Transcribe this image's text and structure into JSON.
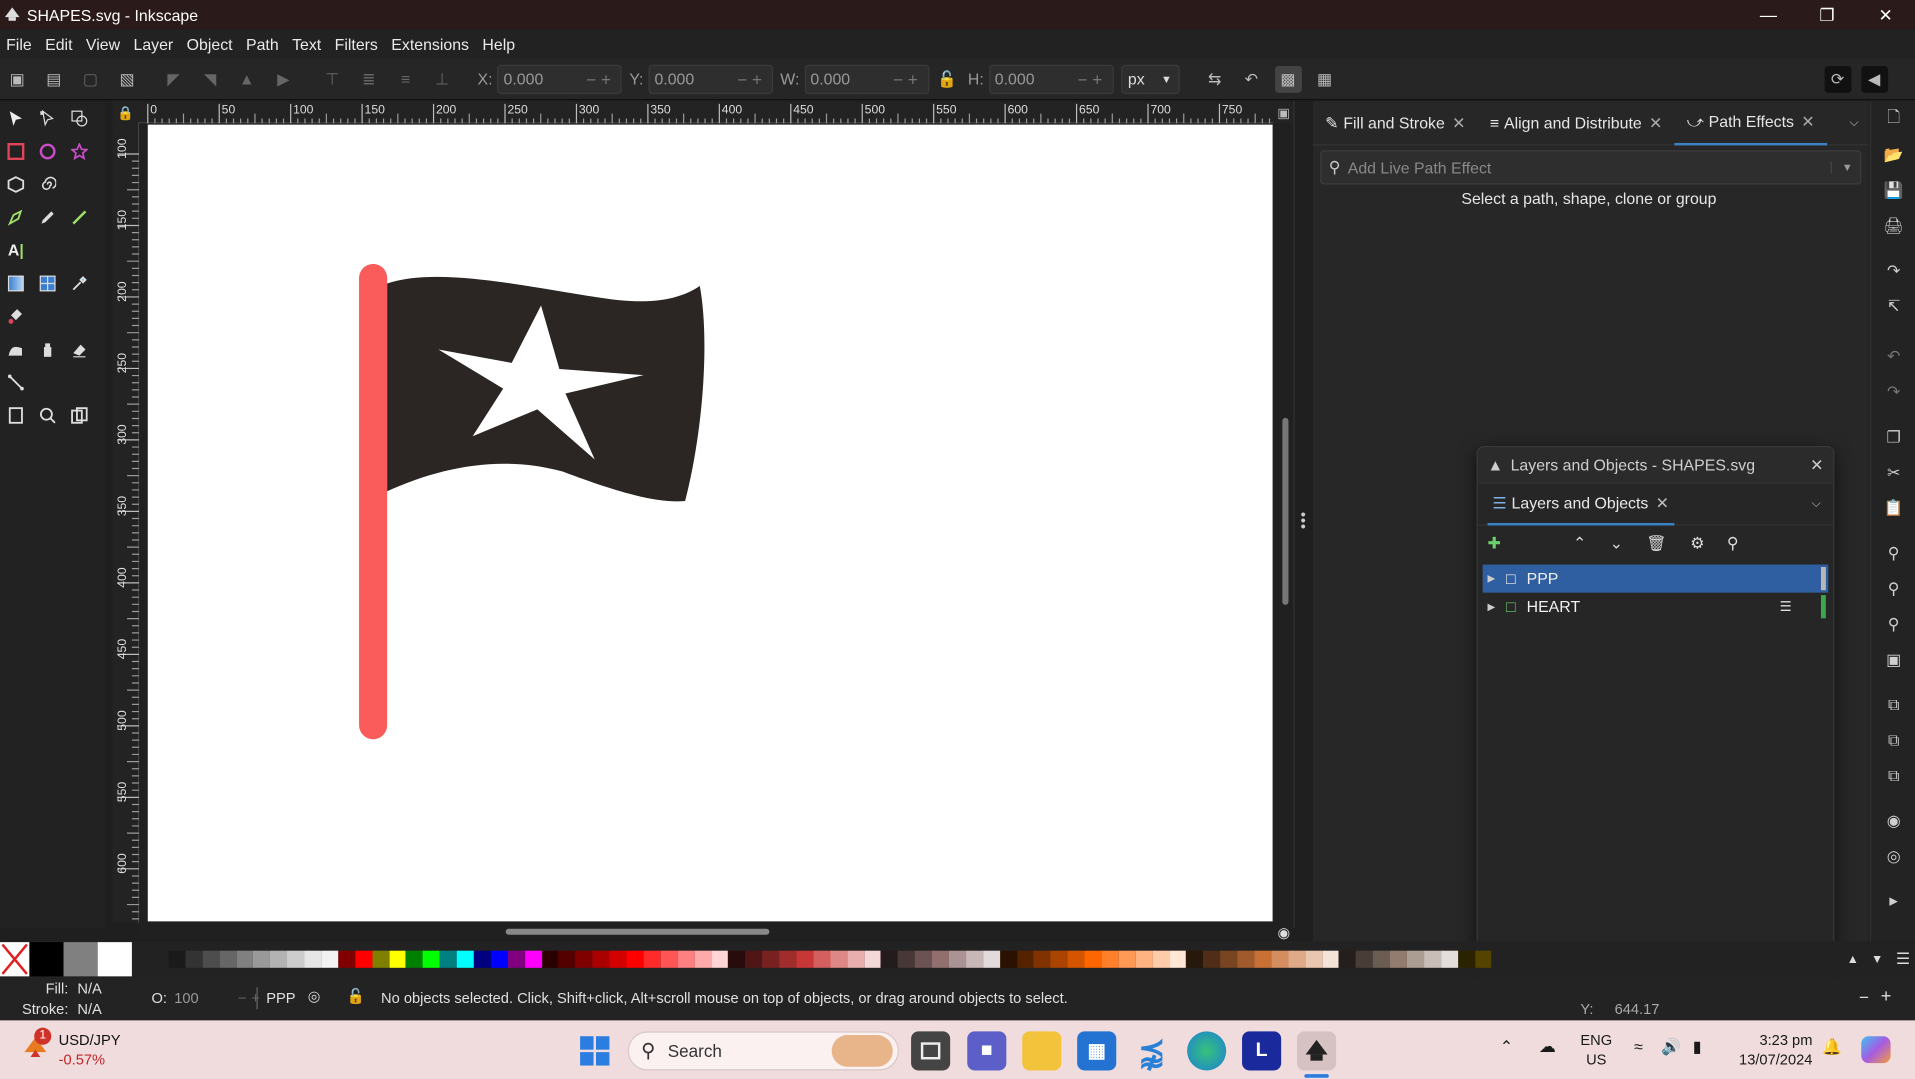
{
  "window": {
    "title": "SHAPES.svg - Inkscape"
  },
  "menu": [
    "File",
    "Edit",
    "View",
    "Layer",
    "Object",
    "Path",
    "Text",
    "Filters",
    "Extensions",
    "Help"
  ],
  "commands": {
    "x_label": "X:",
    "x_value": "0.000",
    "y_label": "Y:",
    "y_value": "0.000",
    "w_label": "W:",
    "w_value": "0.000",
    "h_label": "H:",
    "h_value": "0.000",
    "unit": "px"
  },
  "ruler_h_ticks": [
    "0",
    "50",
    "100",
    "150",
    "200",
    "250",
    "300",
    "350",
    "400",
    "450",
    "500",
    "550",
    "600",
    "650",
    "700",
    "750"
  ],
  "ruler_v_ticks": [
    "100",
    "150",
    "200",
    "250",
    "300",
    "350",
    "400",
    "450",
    "500",
    "550",
    "600"
  ],
  "dock": {
    "tabs": [
      {
        "label": "Fill and Stroke",
        "icon": "fill-stroke-icon"
      },
      {
        "label": "Align and Distribute",
        "icon": "align-icon"
      },
      {
        "label": "Path Effects",
        "icon": "path-effects-icon",
        "active": true
      }
    ],
    "lpe_placeholder": "Add Live Path Effect",
    "lpe_hint": "Select a path, shape, clone or group"
  },
  "layers_window": {
    "title": "Layers and Objects - SHAPES.svg",
    "tab": "Layers and Objects",
    "items": [
      {
        "label": "PPP",
        "selected": true,
        "color": "#b8b8b8"
      },
      {
        "label": "HEART",
        "selected": false,
        "color": "#3aa84a"
      }
    ]
  },
  "status": {
    "fill_label": "Fill:",
    "fill_value": "N/A",
    "stroke_label": "Stroke:",
    "stroke_value": "N/A",
    "opacity_label": "O:",
    "opacity_value": "100",
    "layer": "PPP",
    "message": "No objects selected. Click, Shift+click, Alt+scroll mouse on top of objects, or drag around objects to select.",
    "y_label": "Y:",
    "y_value": "644.17"
  },
  "taskbar": {
    "ticker_name": "USD/JPY",
    "ticker_change": "-0.57%",
    "ticker_badge": "1",
    "search": "Search",
    "lang": "ENG",
    "region": "US",
    "time": "3:23 pm",
    "date": "13/07/2024"
  },
  "colors": {
    "flag": "#2b2523",
    "pole": "#fa5c5c",
    "accent": "#3b82c4"
  }
}
